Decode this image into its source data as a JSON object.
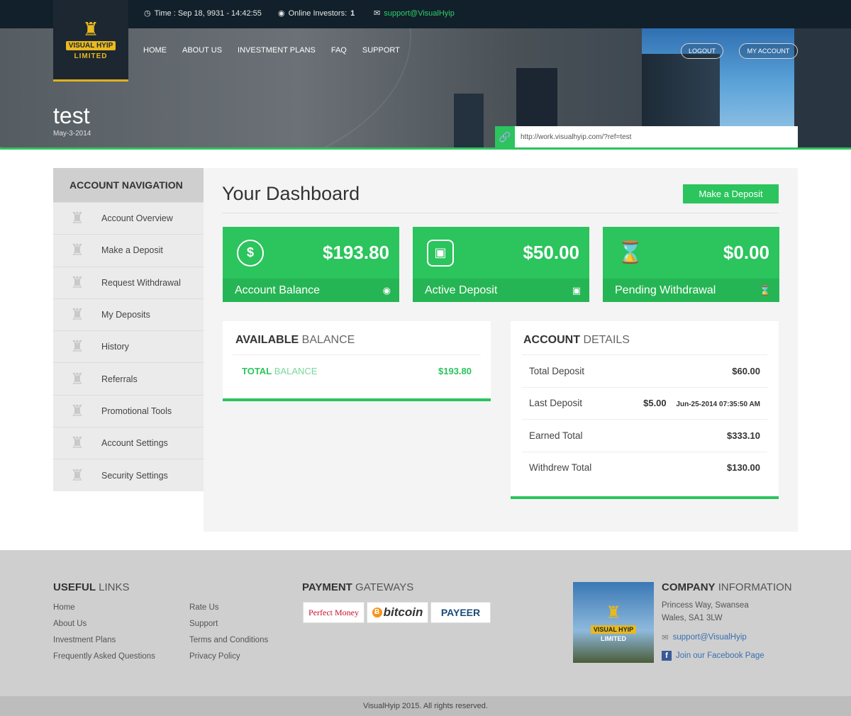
{
  "topbar": {
    "time_label": "Time : Sep 18, 9931 - 14:42:55",
    "investors_label": "Online Investors:",
    "investors_count": "1",
    "email": "support@VisualHyip"
  },
  "logo": {
    "line1": "VISUAL HYIP",
    "line2": "LIMITED"
  },
  "nav": {
    "items": [
      "HOME",
      "ABOUT US",
      "INVESTMENT PLANS",
      "FAQ",
      "SUPPORT"
    ]
  },
  "account_buttons": {
    "logout": "LOGOUT",
    "my_account": "MY ACCOUNT"
  },
  "header": {
    "title": "test",
    "date": "May-3-2014",
    "ref_link": "http://work.visualhyip.com/?ref=test"
  },
  "sidebar": {
    "title": "ACCOUNT NAVIGATION",
    "items": [
      "Account Overview",
      "Make a Deposit",
      "Request Withdrawal",
      "My Deposits",
      "History",
      "Referrals",
      "Promotional Tools",
      "Account Settings",
      "Security Settings"
    ]
  },
  "dashboard": {
    "title": "Your Dashboard",
    "deposit_button": "Make a Deposit",
    "cards": [
      {
        "value": "$193.80",
        "label": "Account Balance"
      },
      {
        "value": "$50.00",
        "label": "Active Deposit"
      },
      {
        "value": "$0.00",
        "label": "Pending Withdrawal"
      }
    ]
  },
  "available_balance": {
    "title_bold": "AVAILABLE",
    "title_rest": "BALANCE",
    "label_bold": "TOTAL",
    "label_rest": "BALANCE",
    "value": "$193.80"
  },
  "account_details": {
    "title_bold": "ACCOUNT",
    "title_rest": "DETAILS",
    "rows": [
      {
        "label": "Total Deposit",
        "value": "$60.00"
      },
      {
        "label": "Last Deposit",
        "value": "$5.00",
        "date": "Jun-25-2014 07:35:50 AM"
      },
      {
        "label": "Earned Total",
        "value": "$333.10"
      },
      {
        "label": "Withdrew Total",
        "value": "$130.00"
      }
    ]
  },
  "footer": {
    "useful_links_bold": "USEFUL",
    "useful_links_rest": "LINKS",
    "links_col1": [
      "Home",
      "About Us",
      "Investment Plans",
      "Frequently Asked Questions"
    ],
    "links_col2": [
      "Rate Us",
      "Support",
      "Terms and Conditions",
      "Privacy Policy"
    ],
    "payment_bold": "PAYMENT",
    "payment_rest": "GATEWAYS",
    "payments": [
      "Perfect Money",
      "bitcoin",
      "PAYEER"
    ],
    "company_bold": "COMPANY",
    "company_rest": "INFORMATION",
    "address_line1": "Princess Way, Swansea",
    "address_line2": "Wales, SA1 3LW",
    "email": "support@VisualHyip",
    "facebook": "Join our Facebook Page",
    "copyright": "VisualHyip 2015. All rights reserved."
  },
  "colors": {
    "accent": "#2bc45d",
    "topbar": "#11202a",
    "logo_gold": "#e9b91e"
  }
}
